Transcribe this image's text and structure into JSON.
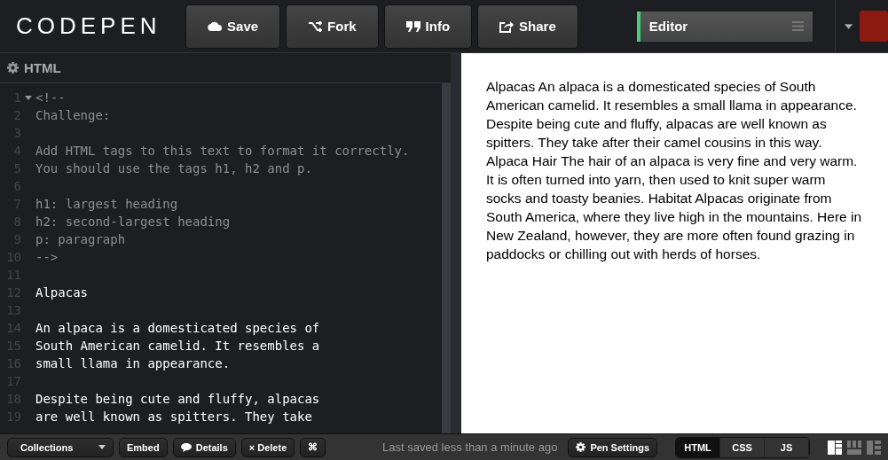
{
  "header": {
    "logo": "CODEPEN",
    "buttons": [
      {
        "label": "Save"
      },
      {
        "label": "Fork"
      },
      {
        "label": "Info"
      },
      {
        "label": "Share"
      }
    ],
    "view_select": "Editor"
  },
  "editor": {
    "title": "HTML",
    "lines": [
      {
        "number": "1",
        "text": "<!--",
        "kind": "comment",
        "foldable": true
      },
      {
        "number": "2",
        "text": "Challenge:",
        "kind": "comment",
        "foldable": false
      },
      {
        "number": "3",
        "foldable": false
      },
      {
        "number": "4",
        "text": "Add HTML tags to this text to format it correctly.",
        "kind": "comment",
        "foldable": false
      },
      {
        "number": "5",
        "text": "You should use the tags h1, h2 and p.",
        "kind": "comment",
        "foldable": false
      },
      {
        "number": "6",
        "foldable": false
      },
      {
        "number": "7",
        "text": "h1: largest heading",
        "kind": "comment",
        "foldable": false
      },
      {
        "number": "8",
        "text": "h2: second-largest heading",
        "kind": "comment",
        "foldable": false
      },
      {
        "number": "9",
        "text": "p: paragraph",
        "kind": "comment",
        "foldable": false
      },
      {
        "number": "10",
        "text": "-->",
        "kind": "comment",
        "foldable": false
      },
      {
        "number": "11",
        "foldable": false
      },
      {
        "number": "12",
        "text": "Alpacas",
        "kind": "text",
        "foldable": false
      },
      {
        "number": "13",
        "foldable": false
      },
      {
        "number": "14",
        "text": "An alpaca is a domesticated species of",
        "kind": "text",
        "foldable": false
      },
      {
        "number": "15",
        "text": "South American camelid. It resembles a",
        "kind": "text",
        "foldable": false
      },
      {
        "number": "16",
        "text": "small llama in appearance.",
        "kind": "text",
        "foldable": false
      },
      {
        "number": "17",
        "foldable": false
      },
      {
        "number": "18",
        "text": "Despite being cute and fluffy, alpacas",
        "kind": "text",
        "foldable": false
      },
      {
        "number": "19",
        "text": "are well known as spitters. They take",
        "kind": "text",
        "foldable": false
      }
    ]
  },
  "preview": {
    "text": "Alpacas An alpaca is a domesticated species of South American camelid. It resembles a small llama in appearance. Despite being cute and fluffy, alpacas are well known as spitters. They take after their camel cousins in this way. Alpaca Hair The hair of an alpaca is very fine and very warm. It is often turned into yarn, then used to knit super warm socks and toasty beanies. Habitat Alpacas originate from South America, where they live high in the mountains. Here in New Zealand, however, they are more often found grazing in paddocks or chilling out with herds of horses."
  },
  "footer": {
    "collections": "Collections",
    "buttons": [
      {
        "label": "Embed"
      },
      {
        "label": "Details"
      },
      {
        "label": "× Delete"
      },
      {
        "label": "⌘"
      }
    ],
    "status": "Last saved less than a minute ago",
    "settings": "Pen Settings",
    "tabs": [
      {
        "label": "HTML",
        "selected": true
      },
      {
        "label": "CSS",
        "selected": false
      },
      {
        "label": "JS",
        "selected": false
      }
    ],
    "layouts": [
      {
        "selected": true
      },
      {
        "selected": false
      },
      {
        "selected": false
      }
    ]
  }
}
